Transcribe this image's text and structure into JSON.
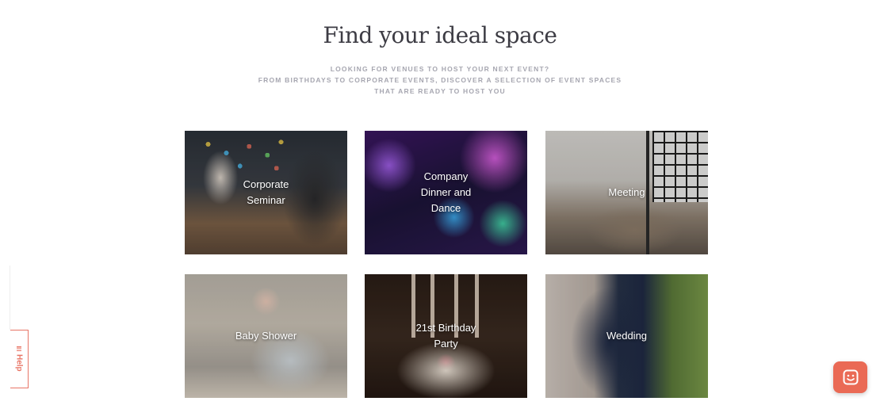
{
  "header": {
    "title": "Find your ideal space",
    "subtitle_lines": [
      "LOOKING FOR VENUES TO HOST YOUR NEXT EVENT?",
      "FROM BIRTHDAYS TO CORPORATE EVENTS, DISCOVER A SELECTION OF EVENT SPACES",
      "THAT ARE READY TO HOST YOU"
    ]
  },
  "categories": [
    {
      "label": "Corporate Seminar"
    },
    {
      "label": "Company Dinner and Dance"
    },
    {
      "label": "Meeting"
    },
    {
      "label": "Baby Shower"
    },
    {
      "label": "21st Birthday Party"
    },
    {
      "label": "Wedding"
    }
  ],
  "help_tab": {
    "label": "Help"
  },
  "chat_button": {
    "icon": "chat-face-icon"
  },
  "colors": {
    "accent": "#ea6a55",
    "title": "#3d3c44",
    "subtitle": "#a6a6b0"
  }
}
